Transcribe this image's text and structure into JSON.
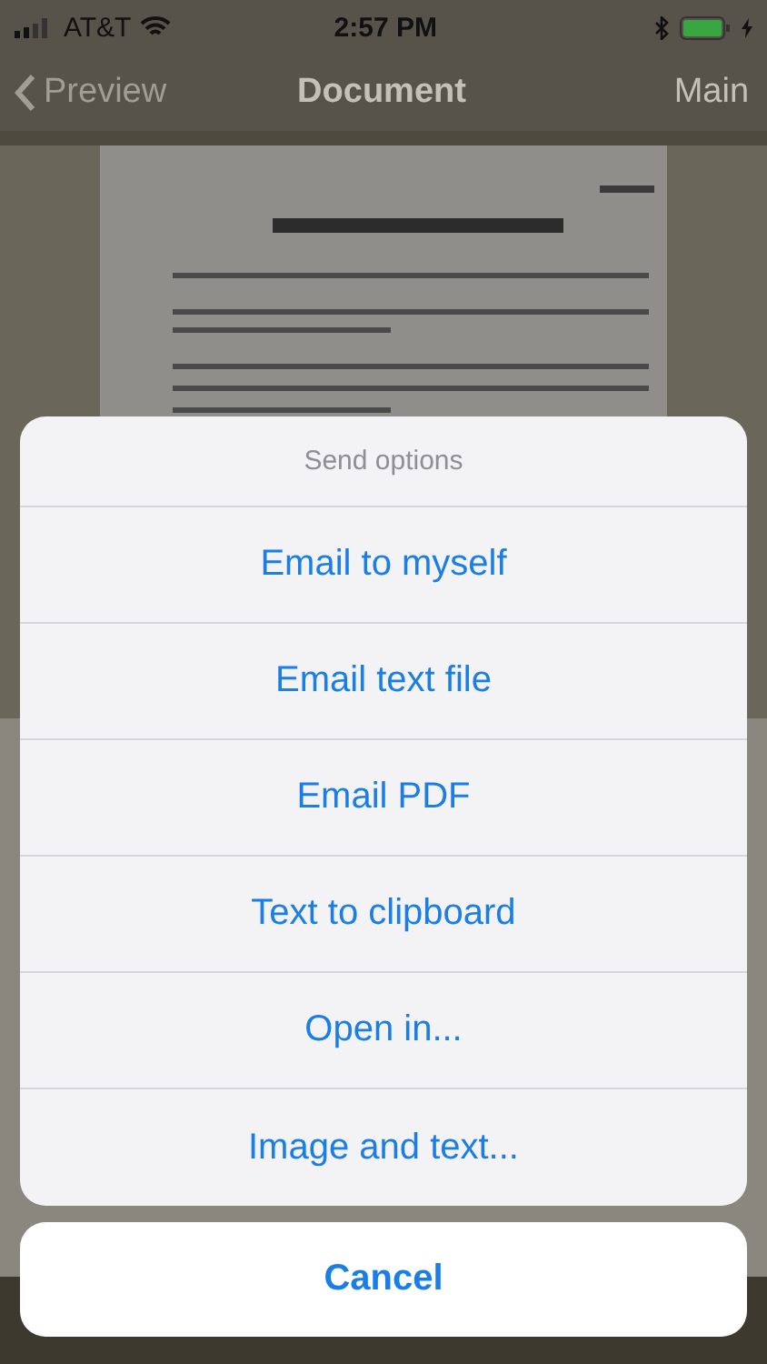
{
  "status_bar": {
    "carrier": "AT&T",
    "time": "2:57 PM"
  },
  "nav_bar": {
    "back": "Preview",
    "title": "Document",
    "action": "Main"
  },
  "action_sheet": {
    "title": "Send options",
    "options": [
      "Email to myself",
      "Email text file",
      "Email PDF",
      "Text to clipboard",
      "Open in...",
      "Image and text..."
    ],
    "cancel": "Cancel"
  }
}
